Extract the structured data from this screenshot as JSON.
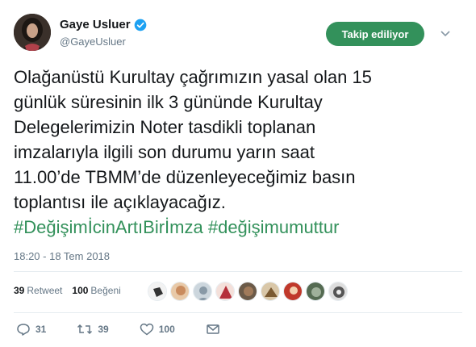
{
  "user": {
    "name": "Gaye Usluer",
    "handle": "@GayeUsluer"
  },
  "follow_button": {
    "label": "Takip ediliyor"
  },
  "tweet": {
    "lines": [
      "Olağanüstü Kurultay çağrımızın yasal olan 15",
      "günlük süresinin ilk 3 gününde Kurultay",
      "Delegelerimizin Noter tasdikli toplanan",
      "imzalarıyla ilgili son durumu yarın saat",
      "11.00’de TBMM’de düzenleyeceğimiz basın",
      "toplantısı ile açıklayacağız."
    ],
    "hashtags": [
      "#DeğişimİcinArtıBirİmza",
      "#değişimumuttur"
    ]
  },
  "timestamp": "18:20 - 18 Tem 2018",
  "stats": {
    "retweets": {
      "count": "39",
      "label": "Retweet"
    },
    "likes": {
      "count": "100",
      "label": "Beğeni"
    }
  },
  "actions": {
    "replies": "31",
    "retweets": "39",
    "likes": "100"
  },
  "colors": {
    "accent": "#33915b",
    "verified": "#1da1f2",
    "muted": "#657786",
    "text": "#14171a"
  },
  "icons": [
    "verified-badge-icon",
    "chevron-down-icon",
    "reply-icon",
    "retweet-icon",
    "heart-icon",
    "message-icon"
  ]
}
